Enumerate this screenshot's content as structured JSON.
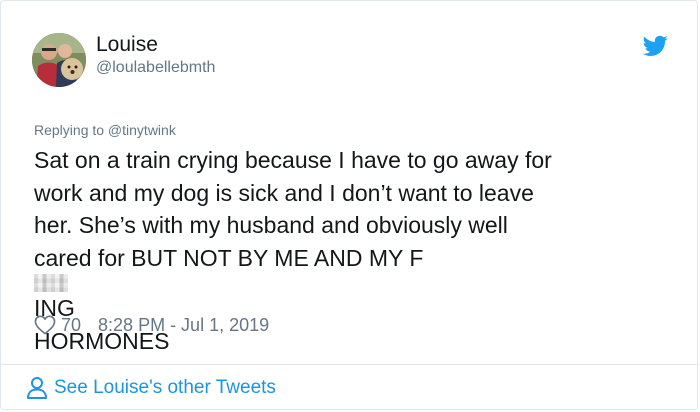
{
  "author": {
    "name": "Louise",
    "handle": "@loulabellebmth",
    "avatar_icon": "avatar-photo"
  },
  "reply": {
    "text": "Replying to @tinytwink"
  },
  "tweet": {
    "lines": [
      "Sat on a train crying because I have to go away for",
      "work and my dog is sick and I don’t want to leave",
      "her. She’s with my husband and  obviously well",
      "cared for BUT NOT BY ME AND MY F",
      "ING",
      "HORMONES"
    ]
  },
  "meta": {
    "likes": "70",
    "timestamp": "8:28 PM - Jul 1, 2019"
  },
  "footer": {
    "link_label": "See Louise's other Tweets"
  },
  "colors": {
    "text": "#14171a",
    "secondary": "#657786",
    "accent": "#1da1f2",
    "link": "#1b95e0",
    "border": "#e1e8ed"
  },
  "icons": {
    "logo": "twitter-bird-icon",
    "like": "heart-icon",
    "profile": "user-icon"
  }
}
